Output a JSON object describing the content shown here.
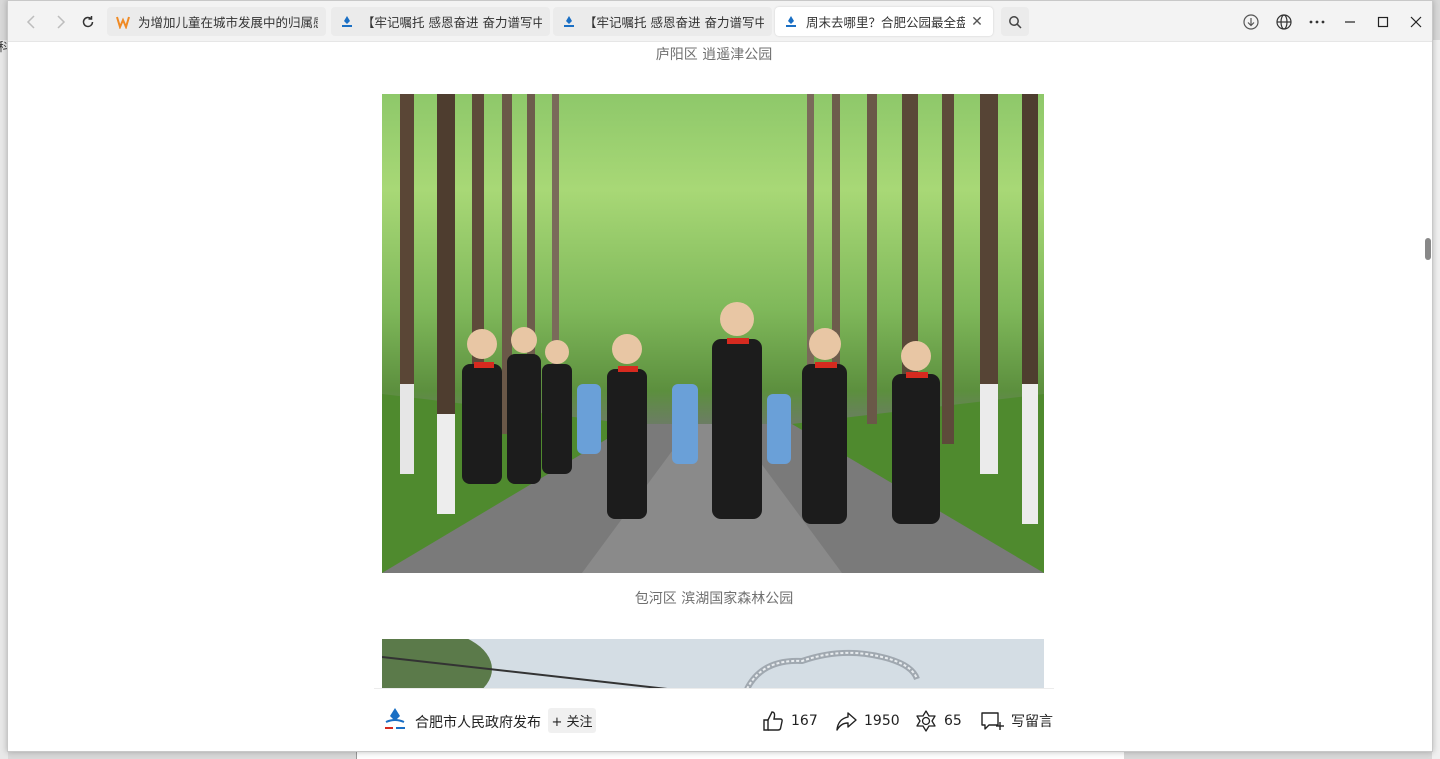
{
  "browser": {
    "tabs": [
      {
        "title": "为增加儿童在城市发展中的归属感",
        "icon": "orange-w-icon",
        "active": false
      },
      {
        "title": "【牢记嘱托 感恩奋进 奋力谱写中国",
        "icon": "hefei-gov-icon",
        "active": false
      },
      {
        "title": "【牢记嘱托 感恩奋进 奋力谱写中国",
        "icon": "hefei-gov-icon",
        "active": false
      },
      {
        "title": "周末去哪里？合肥公园最全盘",
        "icon": "hefei-gov-icon",
        "active": true
      }
    ],
    "close_glyph": "✕"
  },
  "background_page": {
    "edge_char": "科"
  },
  "article": {
    "caption_top": "庐阳区 逍遥津公园",
    "caption_mid": "包河区 滨湖国家森林公园"
  },
  "bottom_bar": {
    "author": "合肥市人民政府发布",
    "follow": "+ 关注",
    "likes": "167",
    "shares": "1950",
    "wows": "65",
    "comment_label": "写留言"
  },
  "colors": {
    "accent_blue": "#1a6fc4",
    "text_gray": "#707070"
  }
}
